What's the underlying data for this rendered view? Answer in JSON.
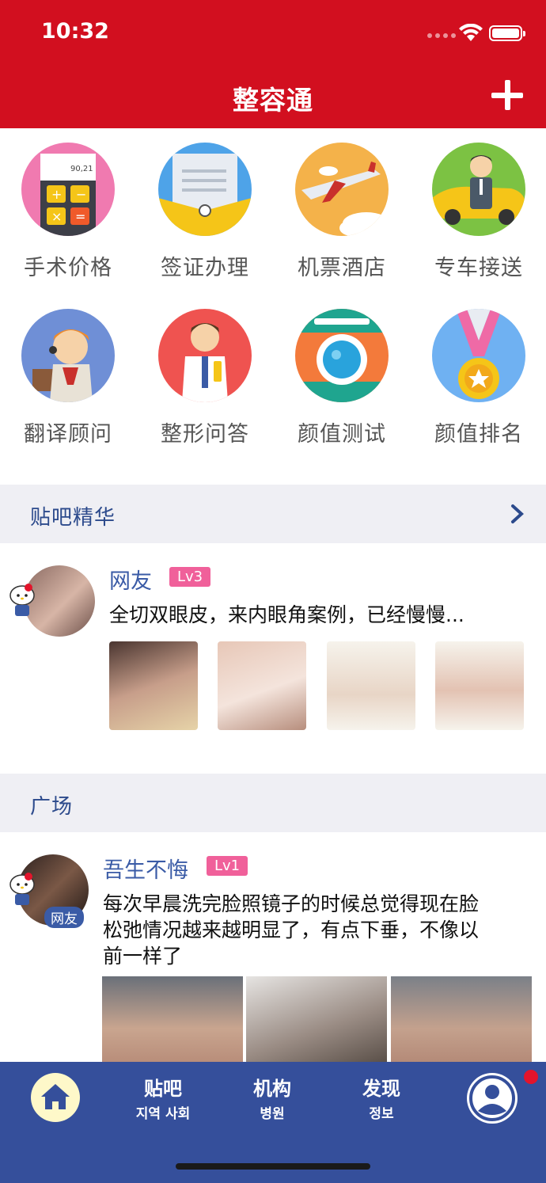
{
  "status_bar": {
    "time": "10:32"
  },
  "nav": {
    "title": "整容通"
  },
  "grid": [
    {
      "label": "手术价格",
      "icon": "calculator-icon",
      "color": "#f07ab0"
    },
    {
      "label": "签证办理",
      "icon": "envelope-icon",
      "color": "#4ea3e8"
    },
    {
      "label": "机票酒店",
      "icon": "airplane-icon",
      "color": "#f4b24a"
    },
    {
      "label": "专车接送",
      "icon": "car-icon",
      "color": "#7cc243"
    },
    {
      "label": "翻译顾问",
      "icon": "headset-agent-icon",
      "color": "#6f8fd6"
    },
    {
      "label": "整形问答",
      "icon": "doctor-icon",
      "color": "#ef5350"
    },
    {
      "label": "颜值测试",
      "icon": "camera-icon",
      "color": "#f37a3b"
    },
    {
      "label": "颜值排名",
      "icon": "medal-icon",
      "color": "#6fb1f2"
    }
  ],
  "sections": {
    "featured": {
      "title": "贴吧精华"
    },
    "square": {
      "title": "广场"
    }
  },
  "featured_post": {
    "username": "网友",
    "level": "Lv3",
    "text": "全切双眼皮，来内眼角案例，已经慢慢..."
  },
  "square_post": {
    "username": "吾生不悔",
    "level": "Lv1",
    "avatar_tag": "网友",
    "text_lines": [
      "每次早晨洗完脸照镜子的时候总觉得现在脸",
      "松弛情况越来越明显了，有点下垂，不像以",
      "前一样了"
    ]
  },
  "tabs": [
    {
      "label": "贴吧",
      "sub": "지역 사회"
    },
    {
      "label": "机构",
      "sub": "병원"
    },
    {
      "label": "发现",
      "sub": "정보"
    }
  ],
  "colors": {
    "brand_red": "#d20f1f",
    "tab_blue": "#354f9b",
    "link_blue": "#3a5ba6",
    "badge_pink": "#f0609a"
  }
}
